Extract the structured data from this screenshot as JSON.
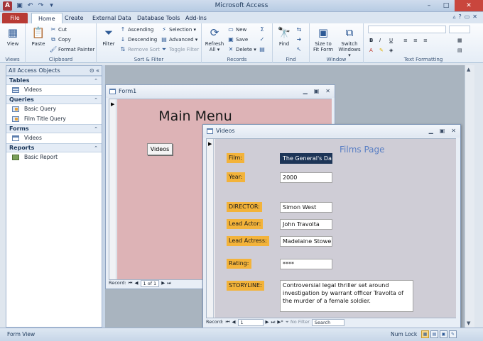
{
  "titlebar": {
    "app_icon": "A",
    "title": "Microsoft Access",
    "qat_icons": [
      "save-icon",
      "undo-icon",
      "redo-icon",
      "customize-icon"
    ],
    "controls": {
      "minimize": "–",
      "maximize": "□",
      "close": "✕"
    }
  },
  "tabs": [
    "File",
    "Home",
    "Create",
    "External Data",
    "Database Tools",
    "Add-Ins"
  ],
  "ribbon": {
    "views": {
      "label": "Views",
      "view": "View"
    },
    "clipboard": {
      "label": "Clipboard",
      "paste": "Paste",
      "cut": "Cut",
      "copy": "Copy",
      "format_painter": "Format Painter"
    },
    "sort_filter": {
      "label": "Sort & Filter",
      "filter": "Filter",
      "ascending": "Ascending",
      "descending": "Descending",
      "remove_sort": "Remove Sort",
      "selection": "Selection",
      "advanced": "Advanced",
      "toggle_filter": "Toggle Filter"
    },
    "records": {
      "label": "Records",
      "refresh": "Refresh",
      "refresh_sub": "All",
      "new": "New",
      "save": "Save",
      "delete": "Delete"
    },
    "find": {
      "label": "Find",
      "find": "Find"
    },
    "window": {
      "label": "Window",
      "size_to_fit": "Size to",
      "size_to_fit_2": "Fit Form",
      "switch": "Switch",
      "switch_2": "Windows"
    },
    "text_formatting": {
      "label": "Text Formatting",
      "bold": "B",
      "italic": "I",
      "underline": "U"
    }
  },
  "nav": {
    "header": "All Access Objects",
    "sections": {
      "tables": {
        "title": "Tables",
        "items": [
          "Videos"
        ]
      },
      "queries": {
        "title": "Queries",
        "items": [
          "Basic Query",
          "Film Title Query"
        ]
      },
      "forms": {
        "title": "Forms",
        "items": [
          "Videos"
        ]
      },
      "reports": {
        "title": "Reports",
        "items": [
          "Basic Report"
        ]
      }
    }
  },
  "form1": {
    "title": "Form1",
    "heading": "Main Menu",
    "videos_button": "Videos",
    "record_label": "Record:",
    "record_value": "1 of 1"
  },
  "videos_form": {
    "title": "Videos",
    "heading": "Films Page",
    "labels": {
      "film": "Film:",
      "year": "Year:",
      "director": "DIRECTOR:",
      "lead_actor": "Lead Actor:",
      "lead_actress": "Lead Actress:",
      "rating": "Rating:",
      "storyline": "STORYLINE:"
    },
    "values": {
      "film": "The General's Dau",
      "year": "2000",
      "director": "Simon West",
      "lead_actor": "John Travolta",
      "lead_actress": "Madelaine Stowe",
      "rating": "****",
      "storyline": "Controversial legal thriller set around investigation by warrant officer Travolta of the murder of a female soldier."
    },
    "record_label": "Record:",
    "record_value": "1",
    "no_filter": "No Filter",
    "search": "Search"
  },
  "statusbar": {
    "left": "Form View",
    "numlock": "Num Lock"
  }
}
